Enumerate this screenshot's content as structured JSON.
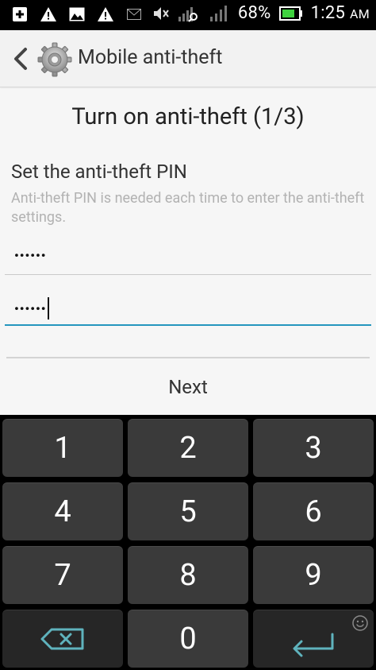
{
  "status_bar": {
    "battery_percent": "68%",
    "time": "1:25",
    "ampm": "AM",
    "icons": [
      "add-box-icon",
      "warning-icon",
      "image-icon",
      "warning-icon",
      "mail-icon",
      "mute-icon",
      "signal-search-icon",
      "signal-icon",
      "battery-icon"
    ]
  },
  "titlebar": {
    "title": "Mobile anti-theft",
    "back_icon": "chevron-left-icon",
    "app_icon": "gear-icon"
  },
  "main": {
    "heading": "Turn on anti-theft (1/3)",
    "section_title": "Set the anti-theft PIN",
    "section_desc": "Anti-theft PIN is needed each time to enter the anti-theft settings.",
    "pin1_value": "••••••",
    "pin2_value": "••••••",
    "next_label": "Next"
  },
  "keypad": {
    "keys": [
      "1",
      "2",
      "3",
      "4",
      "5",
      "6",
      "7",
      "8",
      "9"
    ],
    "zero": "0",
    "backspace_icon": "backspace-icon",
    "enter_icon": "enter-icon",
    "emoji_icon": "emoji-icon"
  },
  "colors": {
    "accent": "#2596be",
    "key_bg": "#3a3a3a",
    "func_key_bg": "#262626",
    "func_key_icon": "#5fb3bd"
  }
}
